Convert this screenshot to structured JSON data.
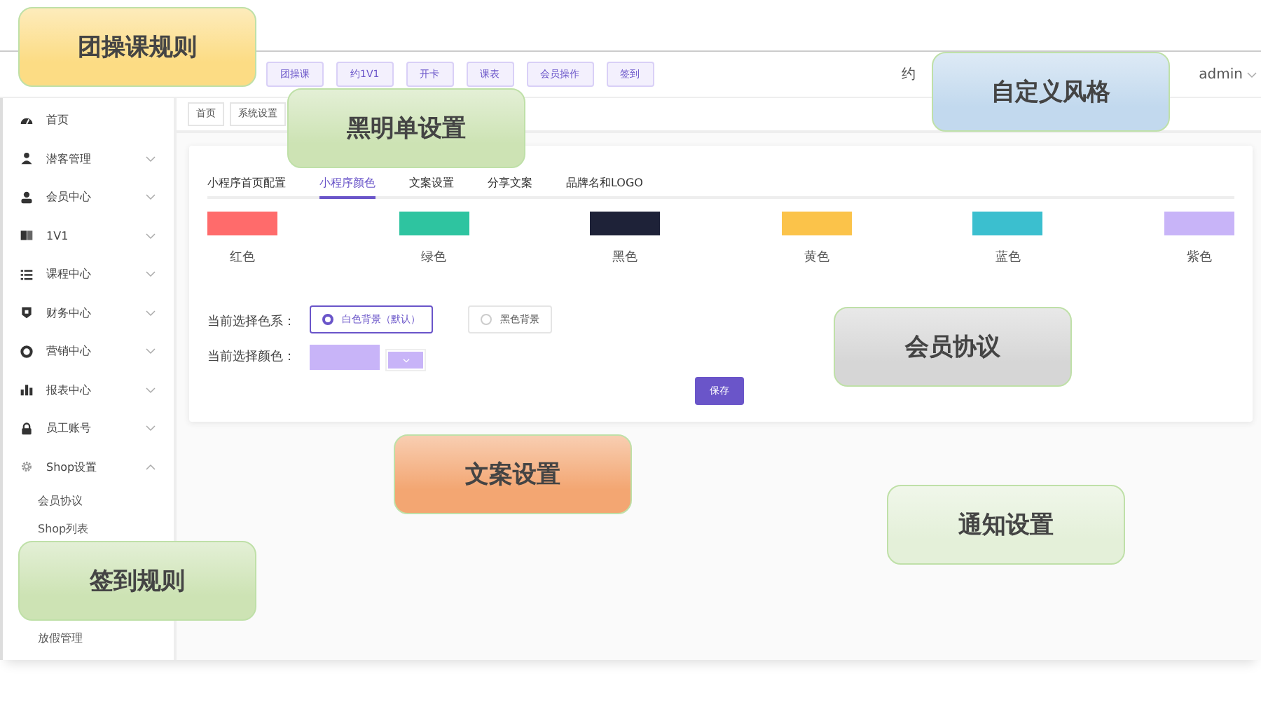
{
  "header": {
    "buttons": [
      "团操课",
      "约1V1",
      "开卡",
      "课表",
      "会员操作",
      "签到"
    ],
    "partial_text": "约",
    "user": "admin"
  },
  "sidebar": {
    "items": [
      {
        "label": "首页",
        "kind": "link"
      },
      {
        "label": "潜客管理",
        "kind": "menu",
        "expanded": false
      },
      {
        "label": "会员中心",
        "kind": "menu",
        "expanded": false
      },
      {
        "label": "1V1",
        "kind": "menu",
        "expanded": false
      },
      {
        "label": "课程中心",
        "kind": "menu",
        "expanded": false
      },
      {
        "label": "财务中心",
        "kind": "menu",
        "expanded": false
      },
      {
        "label": "营销中心",
        "kind": "menu",
        "expanded": false
      },
      {
        "label": "报表中心",
        "kind": "menu",
        "expanded": false
      },
      {
        "label": "员工账号",
        "kind": "menu",
        "expanded": false
      },
      {
        "label": "Shop设置",
        "kind": "menu",
        "expanded": true,
        "children": [
          {
            "label": "会员协议"
          },
          {
            "label": "Shop列表"
          },
          {
            "label": "放假管理"
          }
        ]
      }
    ]
  },
  "breadcrumb": [
    "首页",
    "系统设置"
  ],
  "tabs": [
    {
      "label": "小程序首页配置",
      "selected": false
    },
    {
      "label": "小程序颜色",
      "selected": true
    },
    {
      "label": "文案设置",
      "selected": false
    },
    {
      "label": "分享文案",
      "selected": false
    },
    {
      "label": "品牌名和LOGO",
      "selected": false
    }
  ],
  "swatches": [
    {
      "label": "红色",
      "color": "#ff6b6b"
    },
    {
      "label": "绿色",
      "color": "#2ec4a0"
    },
    {
      "label": "黑色",
      "color": "#1e2238"
    },
    {
      "label": "黄色",
      "color": "#fbc34a"
    },
    {
      "label": "蓝色",
      "color": "#3bbfcf"
    },
    {
      "label": "紫色",
      "color": "#c8b4f8"
    }
  ],
  "scheme": {
    "label": "当前选择色系：",
    "options": [
      {
        "label": "白色背景（默认）",
        "selected": true
      },
      {
        "label": "黑色背景",
        "selected": false
      }
    ]
  },
  "current_color": {
    "label": "当前选择颜色：",
    "color": "#c8b4f8"
  },
  "save_button": "保存",
  "callouts": [
    {
      "text": "团操课规则",
      "color": "#fcdc84"
    },
    {
      "text": "黑明单设置",
      "color": "#cde3b4"
    },
    {
      "text": "自定义风格",
      "color": "#c2d9ee"
    },
    {
      "text": "会员协议",
      "color": "#d6d6d6"
    },
    {
      "text": "文案设置",
      "color": "#f3a672"
    },
    {
      "text": "签到规则",
      "color": "#cde3b4"
    },
    {
      "text": "通知设置",
      "color": "#e4f0d9"
    }
  ]
}
